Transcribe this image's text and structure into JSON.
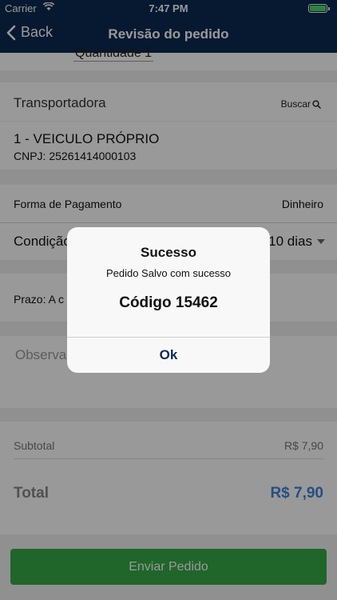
{
  "status_bar": {
    "carrier": "Carrier",
    "time": "7:47 PM"
  },
  "nav": {
    "back_label": "Back",
    "title": "Revisão do pedido"
  },
  "quantity": {
    "label": "Quantidade 1"
  },
  "transportadora": {
    "label": "Transportadora",
    "search_label": "Buscar",
    "name": "1 - VEICULO PRÓPRIO",
    "cnpj": "CNPJ: 25261414000103"
  },
  "payment": {
    "label": "Forma de Pagamento",
    "value": "Dinheiro",
    "condition_label": "Condição",
    "condition_value": "10 dias"
  },
  "prazo": {
    "label": "Prazo: A c"
  },
  "observacao": {
    "placeholder": "Observa"
  },
  "totals": {
    "subtotal_label": "Subtotal",
    "subtotal_value": "R$ 7,90",
    "total_label": "Total",
    "total_value": "R$ 7,90"
  },
  "send_button": {
    "label": "Enviar Pedido"
  },
  "alert": {
    "title": "Sucesso",
    "message": "Pedido Salvo com sucesso",
    "code": "Código 15462",
    "ok_label": "Ok"
  },
  "colors": {
    "nav_bg": "#0d2a52",
    "send_button": "#36a846",
    "total_value": "#3b86d6"
  }
}
